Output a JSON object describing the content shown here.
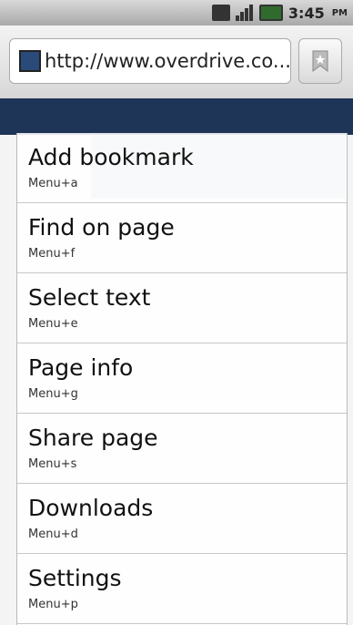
{
  "status_bar": {
    "time": "3:45",
    "ampm": "PM",
    "icons": [
      "3g-data-icon",
      "signal-icon",
      "battery-icon"
    ]
  },
  "url_bar": {
    "url": "http://www.overdrive.co...",
    "bookmark_icon": "bookmark-star-icon"
  },
  "menu": {
    "items": [
      {
        "label": "Add bookmark",
        "shortcut": "Menu+a"
      },
      {
        "label": "Find on page",
        "shortcut": "Menu+f"
      },
      {
        "label": "Select text",
        "shortcut": "Menu+e"
      },
      {
        "label": "Page info",
        "shortcut": "Menu+g"
      },
      {
        "label": "Share page",
        "shortcut": "Menu+s"
      },
      {
        "label": "Downloads",
        "shortcut": "Menu+d"
      },
      {
        "label": "Settings",
        "shortcut": "Menu+p"
      }
    ]
  }
}
